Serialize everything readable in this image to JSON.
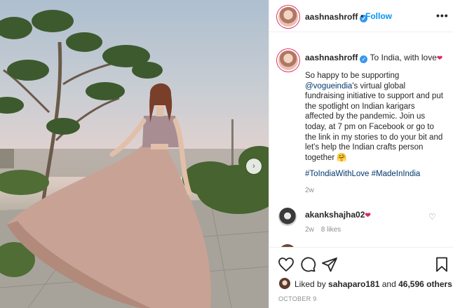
{
  "post": {
    "username": "aashnashroff",
    "follow_label": "Follow",
    "separator": "•",
    "more_label": "•••",
    "carousel_next": "›"
  },
  "caption": {
    "username": "aashnashroff",
    "title": "To India, with love",
    "text_before_mention": "So happy to be supporting ",
    "mention": "@vogueindia",
    "text_after_mention": "'s virtual global fundraising initiative to support and put the spotlight on Indian karigars affected by the pandemic. Join us today, at 7 pm on Facebook or go to the link in my stories to do your bit and let's help the Indian crafts person together 🤗",
    "hashtags": "#ToIndiaWithLove #MadeInIndia",
    "time": "2w"
  },
  "comment": {
    "username": "akankshajha02",
    "time": "2w",
    "likes": "8 likes"
  },
  "likes": {
    "prefix": "Liked by ",
    "user": "sahaparo181",
    "conjunction": " and ",
    "count": "46,596 others"
  },
  "date": "OCTOBER 9",
  "colors": {
    "accent": "#0095f6",
    "verified": "#3897f0",
    "heart": "#e0245e",
    "link": "#00376b",
    "muted": "#8e8e8e"
  },
  "icons": [
    "verified-icon",
    "heart-icon",
    "comment-icon",
    "share-icon",
    "bookmark-icon",
    "more-icon",
    "chevron-right-icon"
  ]
}
